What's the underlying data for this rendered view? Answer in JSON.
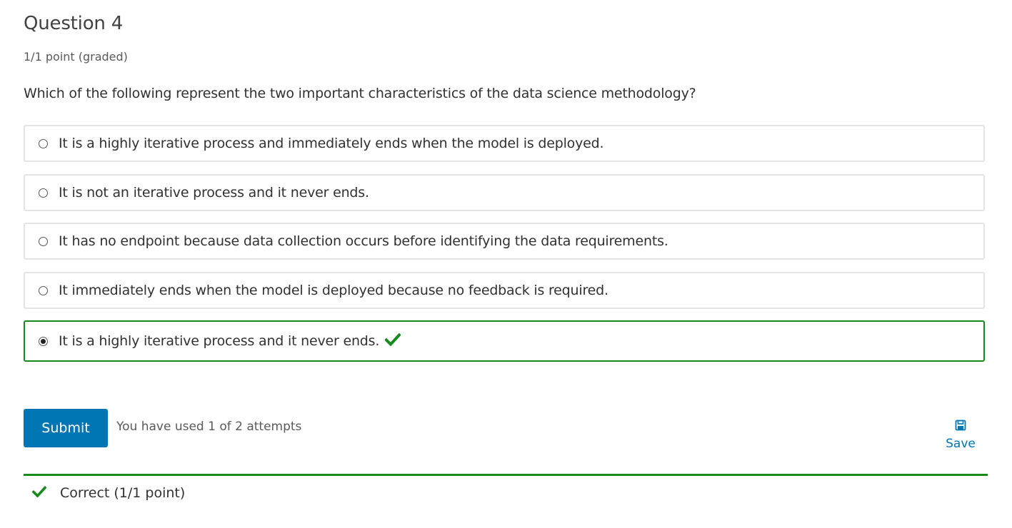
{
  "question": {
    "title": "Question 4",
    "points": "1/1 point (graded)",
    "prompt": "Which of the following represent the two important characteristics of the data science methodology?"
  },
  "choices": [
    {
      "label": "It is a highly iterative process and immediately ends when the model is deployed.",
      "selected": false,
      "correct": false
    },
    {
      "label": "It is not an iterative process and it never ends.",
      "selected": false,
      "correct": false
    },
    {
      "label": "It has no endpoint because data collection occurs before identifying the data requirements.",
      "selected": false,
      "correct": false
    },
    {
      "label": "It immediately ends when the model is deployed because no feedback is required.",
      "selected": false,
      "correct": false
    },
    {
      "label": "It is a highly iterative process and it never ends.",
      "selected": true,
      "correct": true
    }
  ],
  "actions": {
    "submit_label": "Submit",
    "attempts_text": "You have used 1 of 2 attempts",
    "save_label": "Save"
  },
  "feedback": {
    "text": "Correct (1/1 point)"
  },
  "colors": {
    "accent": "#0075b4",
    "correct": "#178a1c"
  },
  "icons": {
    "correct": "checkmark-icon",
    "save": "floppy-disk-icon"
  }
}
